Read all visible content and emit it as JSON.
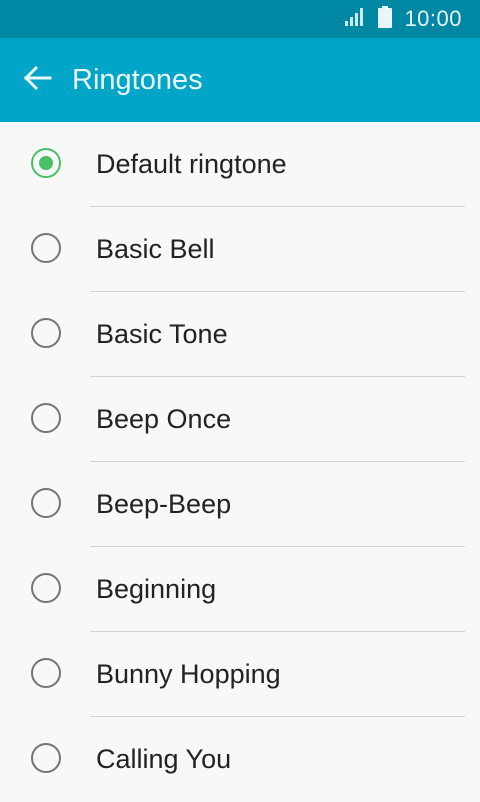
{
  "status_bar": {
    "time": "10:00",
    "icons": [
      "signal-icon",
      "battery-icon"
    ]
  },
  "toolbar": {
    "back_icon": "back-arrow-icon",
    "title": "Ringtones"
  },
  "colors": {
    "status_bar": "#0087a4",
    "toolbar": "#00a5c7",
    "accent_selected": "#48c164",
    "background": "#f8f8f8"
  },
  "ringtones": {
    "selected_index": 0,
    "items": [
      {
        "label": "Default ringtone",
        "selected": true
      },
      {
        "label": "Basic Bell",
        "selected": false
      },
      {
        "label": "Basic Tone",
        "selected": false
      },
      {
        "label": "Beep Once",
        "selected": false
      },
      {
        "label": "Beep-Beep",
        "selected": false
      },
      {
        "label": "Beginning",
        "selected": false
      },
      {
        "label": "Bunny Hopping",
        "selected": false
      },
      {
        "label": "Calling You",
        "selected": false
      }
    ]
  }
}
